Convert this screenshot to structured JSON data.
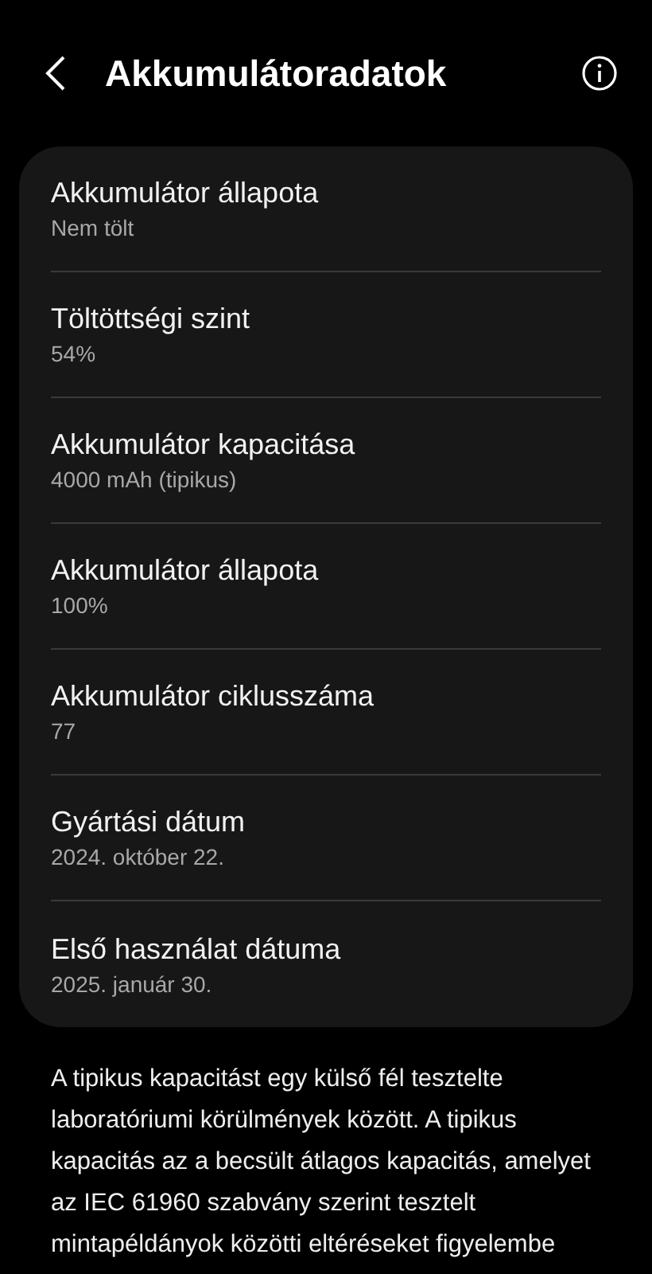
{
  "header": {
    "title": "Akkumulátoradatok"
  },
  "items": [
    {
      "title": "Akkumulátor állapota",
      "value": "Nem tölt"
    },
    {
      "title": "Töltöttségi szint",
      "value": "54%"
    },
    {
      "title": "Akkumulátor kapacitása",
      "value": "4000 mAh (tipikus)"
    },
    {
      "title": "Akkumulátor állapota",
      "value": "100%"
    },
    {
      "title": "Akkumulátor ciklusszáma",
      "value": "77"
    },
    {
      "title": "Gyártási dátum",
      "value": "2024. október 22."
    },
    {
      "title": "Első használat dátuma",
      "value": "2025. január 30."
    }
  ],
  "note": "A tipikus kapacitást egy külső fél tesztelte laboratóriumi körülmények között. A tipikus kapacitás az a becsült átlagos kapacitás, amelyet az IEC 61960 szabvány szerint tesztelt mintapéldányok közötti eltéréseket figyelembe"
}
